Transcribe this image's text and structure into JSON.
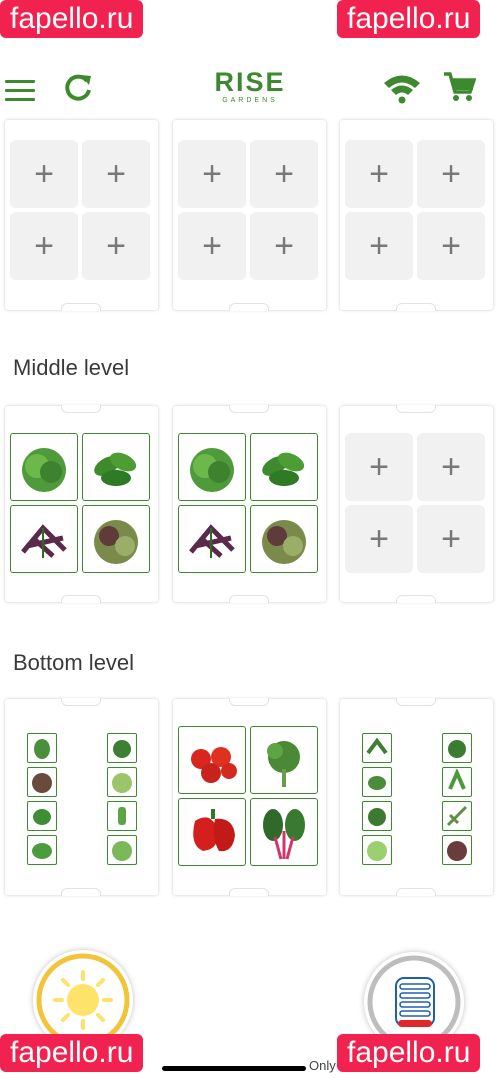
{
  "header": {
    "menu_icon": "hamburger-menu-icon",
    "refresh_icon": "refresh-icon",
    "logo_main": "RISE",
    "logo_sub": "GARDENS",
    "wifi_icon": "wifi-icon",
    "cart_icon": "shopping-cart-icon"
  },
  "accent": "#3d8a2e",
  "slot_add_symbol": "+",
  "sections": {
    "middle_label": "Middle level",
    "bottom_label": "Bottom level"
  },
  "controls": {
    "light_icon": "sun-icon",
    "tank_icon": "water-tank-icon"
  },
  "watermarks": [
    "fapello.ru",
    "fapello.ru",
    "fapello.ru",
    "fapello.ru"
  ],
  "footer_text": "Only"
}
